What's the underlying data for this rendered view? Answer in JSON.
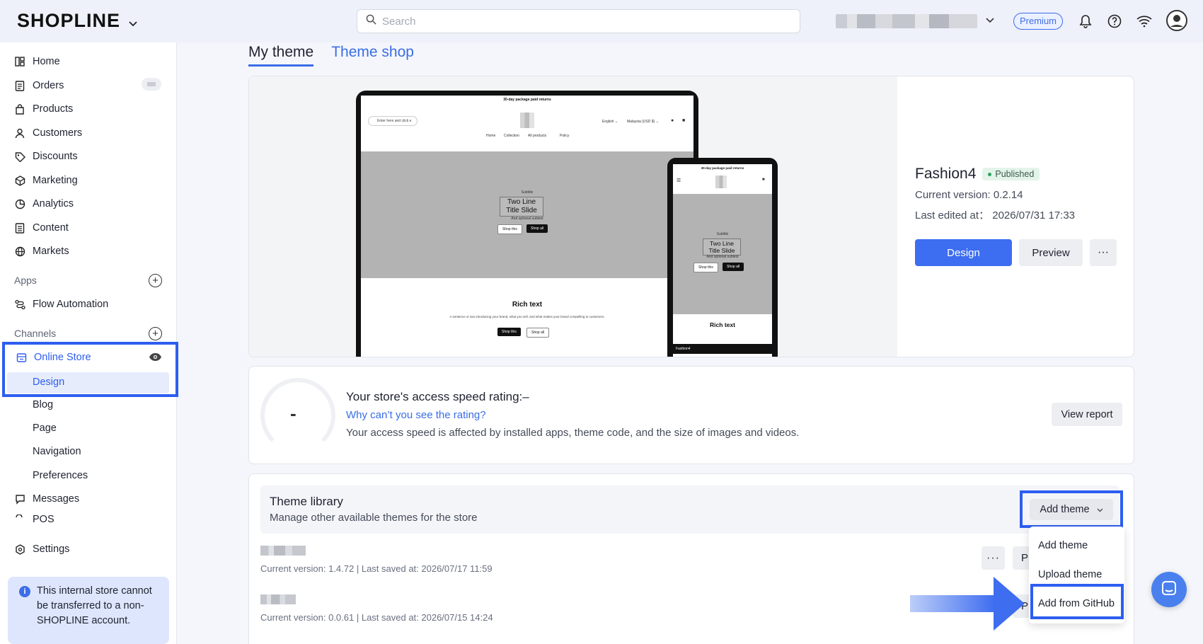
{
  "topbar": {
    "logo": "SHOPLINE",
    "search_placeholder": "Search",
    "plan_badge": "Premium"
  },
  "sidebar": {
    "items": [
      {
        "label": "Home",
        "icon": "home-icon"
      },
      {
        "label": "Orders",
        "icon": "orders-icon"
      },
      {
        "label": "Products",
        "icon": "bag-icon"
      },
      {
        "label": "Customers",
        "icon": "person-icon"
      },
      {
        "label": "Discounts",
        "icon": "tag-icon"
      },
      {
        "label": "Marketing",
        "icon": "megaphone-icon"
      },
      {
        "label": "Analytics",
        "icon": "pie-chart-icon"
      },
      {
        "label": "Content",
        "icon": "document-icon"
      },
      {
        "label": "Markets",
        "icon": "globe-icon"
      }
    ],
    "apps_label": "Apps",
    "flow_automation": "Flow Automation",
    "channels_label": "Channels",
    "online_store": "Online Store",
    "online_store_sub": [
      "Design",
      "Blog",
      "Page",
      "Navigation",
      "Preferences"
    ],
    "messages": "Messages",
    "pos": "POS",
    "settings": "Settings",
    "notice": "This internal store cannot be transferred to a non-SHOPLINE account."
  },
  "tabs": [
    "My theme",
    "Theme shop"
  ],
  "current_theme": {
    "name": "Fashion4",
    "status": "Published",
    "version": "Current version: 0.2.14",
    "last_edited": "Last edited at： 2026/07/31 17:33",
    "design_label": "Design",
    "preview_label": "Preview",
    "more_label": "···"
  },
  "mockup": {
    "announcement": "30-day package paid returns",
    "search_text": "Enter here and click e",
    "lang": "English ⌄",
    "currency": "Malaysia (USD $) ⌄",
    "nav": [
      "Home",
      "Collection",
      "All products",
      "Policy"
    ],
    "hero_subtitle": "Subtitle",
    "hero_title": "Two Line Title Slide",
    "hero_tagline": "And optional subtext",
    "shop_this": "Shop this",
    "shop_all": "Shop all",
    "rich_text": "Rich text",
    "rich_desc": "A sentence or two introducing your brand, what you sell, and what makes your brand compelling to customers.",
    "phone_footer": "Fashion4"
  },
  "speed": {
    "value": "-",
    "title": "Your store's access speed rating:–",
    "link": "Why can’t you see the rating?",
    "description": "Your access speed is affected by installed apps, theme code, and the size of images and videos.",
    "report_label": "View report"
  },
  "library": {
    "title": "Theme library",
    "subtitle": "Manage other available themes for the store",
    "add_theme_label": "Add theme",
    "rows": [
      {
        "meta": "Current version: 1.4.72  |  Last saved at: 2026/07/17 11:59"
      },
      {
        "meta": "Current version: 0.0.61  |  Last saved at: 2026/07/15 14:24"
      }
    ],
    "row_button_partial": "Pr",
    "dropdown": [
      "Add theme",
      "Upload theme",
      "Add from GitHub"
    ]
  },
  "colors": {
    "accent": "#3d6df0",
    "highlight": "#2d5ef0",
    "published_bg": "#e3f4ea"
  }
}
